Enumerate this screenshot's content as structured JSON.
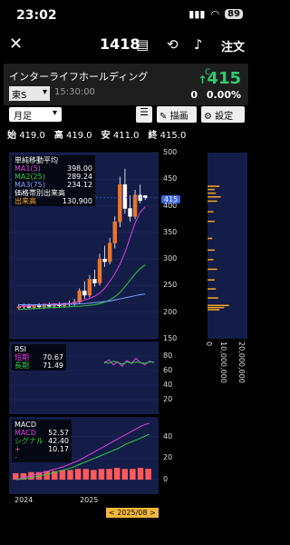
{
  "status": {
    "time": "23:02",
    "battery": "89"
  },
  "nav": {
    "code": "1418",
    "order": "注文"
  },
  "stock": {
    "name": "インターライフホールディング",
    "market": "東S",
    "time": "15:30:00",
    "price_prefix": "C",
    "price": "415",
    "change": "0",
    "change_pct": "0.00%"
  },
  "controls": {
    "period": "月足",
    "draw": "描画",
    "settings": "設定"
  },
  "ohlc": {
    "open_label": "始",
    "open": "419.0",
    "high_label": "高",
    "high": "419.0",
    "low_label": "安",
    "low": "411.0",
    "close_label": "終",
    "close": "415.0"
  },
  "main_legend": {
    "title": "単純移動平均",
    "ma1_label": "MA1(5)",
    "ma1_value": "398.00",
    "ma2_label": "MA2(25)",
    "ma2_value": "289.24",
    "ma3_label": "MA3(75)",
    "ma3_value": "234.12",
    "vp_title": "価格帯別出来高",
    "vp_label": "出来高",
    "vp_value": "130,900"
  },
  "price_axis": [
    "500",
    "450",
    "400",
    "350",
    "300",
    "250",
    "200",
    "150"
  ],
  "price_tag": "415",
  "volume_axis": [
    "0",
    "10,000,000",
    "20,000,000"
  ],
  "rsi_legend": {
    "title": "RSI",
    "short_label": "短期",
    "short_value": "70.67",
    "long_label": "長期",
    "long_value": "71.49"
  },
  "rsi_axis": [
    "80",
    "60",
    "40",
    "20"
  ],
  "macd_legend": {
    "title": "MACD",
    "macd_label": "MACD",
    "macd_value": "52.57",
    "signal_label": "シグナル",
    "signal_value": "42.40",
    "plus_label": "+",
    "plus_value": "10.17",
    "minus_label": "-"
  },
  "macd_axis": [
    "40",
    "20",
    "0"
  ],
  "date_axis": [
    "2024",
    "2025"
  ],
  "date_tag": "< 2025/08 >",
  "colors": {
    "price_up": "#2ecc71",
    "candle": "#e8772e",
    "ma1": "#e040e0",
    "ma2": "#2ecc40",
    "ma3": "#7aa0ff",
    "panel": "#141c48",
    "accent": "#3a63e8",
    "vp": "#f5a623"
  },
  "chart_data": [
    {
      "type": "line",
      "title": "",
      "ylim": [
        150,
        500
      ],
      "series": [
        {
          "name": "MA1(5)",
          "values": [
            210,
            212,
            211,
            214,
            213,
            215,
            214,
            216,
            215,
            217,
            216,
            218,
            220,
            223,
            226,
            230,
            236,
            245,
            258,
            272,
            290,
            312,
            340,
            368,
            388,
            398
          ]
        },
        {
          "name": "MA2(25)",
          "values": [
            205,
            206,
            206,
            207,
            207,
            208,
            208,
            209,
            209,
            210,
            210,
            211,
            211,
            212,
            213,
            214,
            216,
            219,
            223,
            229,
            237,
            248,
            260,
            272,
            282,
            289
          ]
        },
        {
          "name": "MA3(75)",
          "values": [
            214,
            214,
            214,
            214,
            214,
            214,
            214,
            214,
            214,
            215,
            215,
            215,
            216,
            216,
            217,
            218,
            219,
            220,
            221,
            223,
            225,
            227,
            229,
            231,
            233,
            234
          ]
        }
      ],
      "candles": [
        {
          "o": 210,
          "h": 215,
          "l": 205,
          "c": 210
        },
        {
          "o": 210,
          "h": 216,
          "l": 206,
          "c": 212
        },
        {
          "o": 212,
          "h": 216,
          "l": 207,
          "c": 209
        },
        {
          "o": 209,
          "h": 215,
          "l": 205,
          "c": 212
        },
        {
          "o": 212,
          "h": 217,
          "l": 208,
          "c": 210
        },
        {
          "o": 210,
          "h": 216,
          "l": 206,
          "c": 213
        },
        {
          "o": 213,
          "h": 218,
          "l": 209,
          "c": 211
        },
        {
          "o": 211,
          "h": 217,
          "l": 207,
          "c": 214
        },
        {
          "o": 214,
          "h": 219,
          "l": 209,
          "c": 212
        },
        {
          "o": 212,
          "h": 218,
          "l": 208,
          "c": 215
        },
        {
          "o": 215,
          "h": 222,
          "l": 211,
          "c": 217
        },
        {
          "o": 217,
          "h": 225,
          "l": 212,
          "c": 219
        },
        {
          "o": 219,
          "h": 245,
          "l": 215,
          "c": 240
        },
        {
          "o": 240,
          "h": 258,
          "l": 225,
          "c": 232
        },
        {
          "o": 232,
          "h": 270,
          "l": 228,
          "c": 262
        },
        {
          "o": 262,
          "h": 280,
          "l": 248,
          "c": 255
        },
        {
          "o": 255,
          "h": 310,
          "l": 250,
          "c": 300
        },
        {
          "o": 300,
          "h": 325,
          "l": 285,
          "c": 295
        },
        {
          "o": 295,
          "h": 340,
          "l": 290,
          "c": 330
        },
        {
          "o": 330,
          "h": 380,
          "l": 320,
          "c": 370
        },
        {
          "o": 370,
          "h": 455,
          "l": 360,
          "c": 440
        },
        {
          "o": 440,
          "h": 470,
          "l": 385,
          "c": 395
        },
        {
          "o": 395,
          "h": 420,
          "l": 370,
          "c": 380
        },
        {
          "o": 380,
          "h": 430,
          "l": 375,
          "c": 420
        },
        {
          "o": 420,
          "h": 440,
          "l": 405,
          "c": 410
        },
        {
          "o": 419,
          "h": 419,
          "l": 411,
          "c": 415
        }
      ]
    },
    {
      "type": "line",
      "title": "RSI",
      "ylim": [
        0,
        100
      ],
      "series": [
        {
          "name": "短期",
          "values": [
            70,
            75,
            68,
            72,
            66,
            74,
            70,
            77,
            71,
            68,
            73,
            70.67
          ]
        },
        {
          "name": "長期",
          "values": [
            72,
            70,
            73,
            71,
            69,
            72,
            70,
            72,
            71,
            70,
            72,
            71.49
          ]
        }
      ]
    },
    {
      "type": "bar",
      "title": "MACD",
      "ylim": [
        -5,
        55
      ],
      "series": [
        {
          "name": "MACD",
          "values": [
            0,
            2,
            4,
            6,
            8,
            10,
            12,
            15,
            18,
            22,
            26,
            30,
            34,
            38,
            42,
            46,
            50,
            52.57
          ]
        },
        {
          "name": "シグナル",
          "values": [
            0,
            1,
            2,
            4,
            5,
            7,
            9,
            11,
            14,
            17,
            20,
            23,
            26,
            29,
            33,
            36,
            39,
            42.4
          ]
        },
        {
          "name": "+",
          "values": [
            6,
            6,
            7,
            7,
            8,
            8,
            9,
            9,
            10,
            10,
            9,
            10,
            10,
            11,
            10,
            10,
            11,
            10.17
          ]
        }
      ]
    }
  ]
}
